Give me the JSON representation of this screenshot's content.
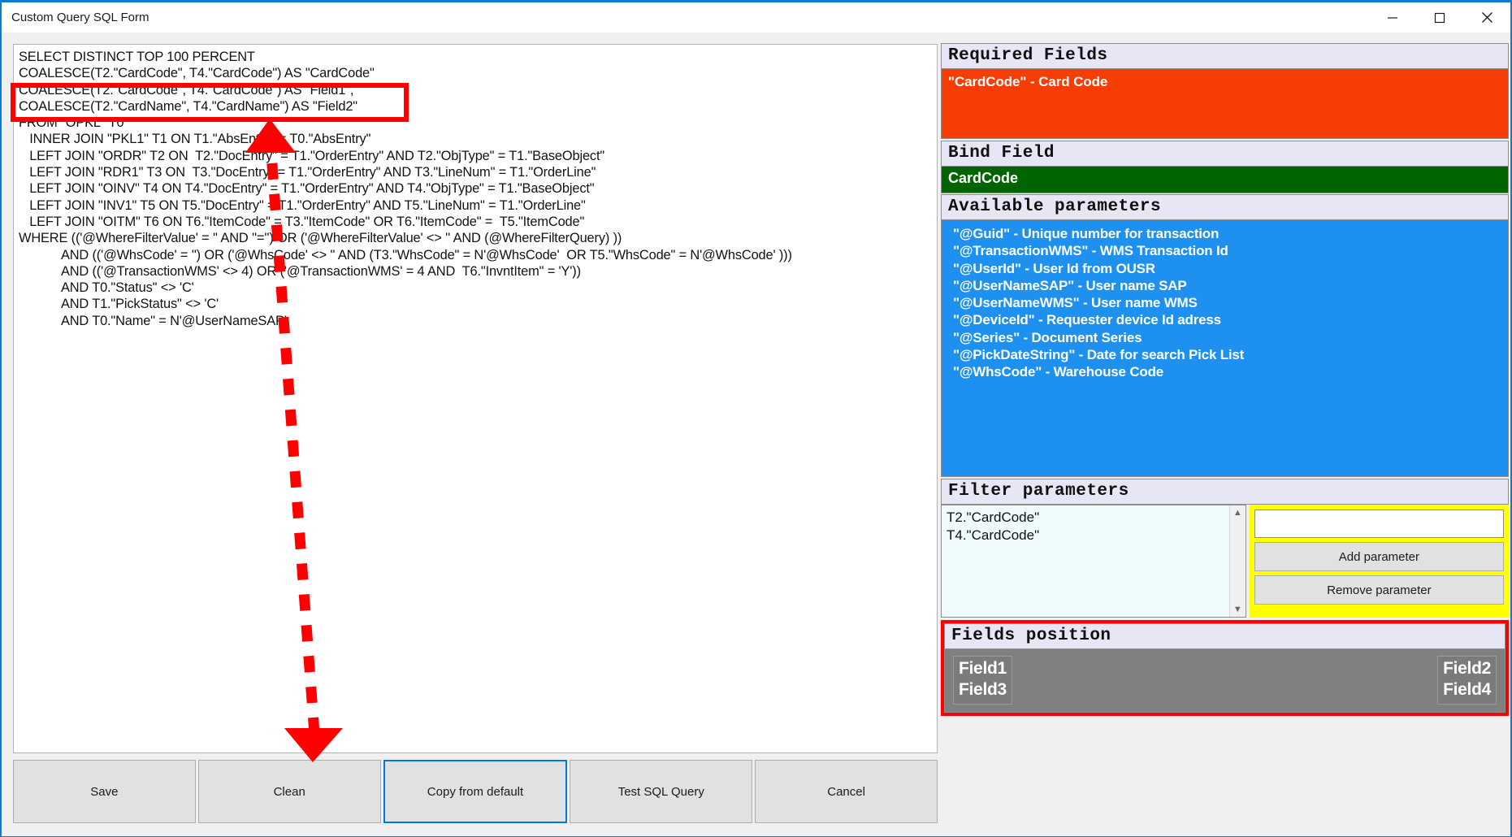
{
  "window": {
    "title": "Custom Query SQL Form",
    "controls": [
      {
        "name": "minimize",
        "glyph": "minimize-icon"
      },
      {
        "name": "maximize",
        "glyph": "maximize-icon"
      },
      {
        "name": "close",
        "glyph": "close-icon"
      }
    ]
  },
  "editor": {
    "sql": "SELECT DISTINCT TOP 100 PERCENT\nCOALESCE(T2.\"CardCode\", T4.\"CardCode\") AS \"CardCode\"\nCOALESCE(T2.\"CardCode\", T4.\"CardCode\") AS \"Field1\",\nCOALESCE(T2.\"CardName\", T4.\"CardName\") AS \"Field2\"\nFROM \"OPKL\" T0\n   INNER JOIN \"PKL1\" T1 ON T1.\"AbsEntry\" = T0.\"AbsEntry\"\n   LEFT JOIN \"ORDR\" T2 ON  T2.\"DocEntry\" = T1.\"OrderEntry\" AND T2.\"ObjType\" = T1.\"BaseObject\"\n   LEFT JOIN \"RDR1\" T3 ON  T3.\"DocEntry\" = T1.\"OrderEntry\" AND T3.\"LineNum\" = T1.\"OrderLine\"\n   LEFT JOIN \"OINV\" T4 ON T4.\"DocEntry\" = T1.\"OrderEntry\" AND T4.\"ObjType\" = T1.\"BaseObject\"\n   LEFT JOIN \"INV1\" T5 ON T5.\"DocEntry\" = T1.\"OrderEntry\" AND T5.\"LineNum\" = T1.\"OrderLine\"\n   LEFT JOIN \"OITM\" T6 ON T6.\"ItemCode\" = T3.\"ItemCode\" OR T6.\"ItemCode\" =  T5.\"ItemCode\"\nWHERE (('@WhereFilterValue' = '' AND ''='') OR ('@WhereFilterValue' <> '' AND (@WhereFilterQuery) ))\n            AND (('@WhsCode' = '') OR ('@WhsCode' <> '' AND (T3.\"WhsCode\" = N'@WhsCode'  OR T5.\"WhsCode\" = N'@WhsCode' )))\n            AND (('@TransactionWMS' <> 4) OR ('@TransactionWMS' = 4 AND  T6.\"InvntItem\" = 'Y'))\n            AND T0.\"Status\" <> 'C'\n            AND T1.\"PickStatus\" <> 'C'\n            AND T0.\"Name\" = N'@UserNameSAP'"
  },
  "buttons": {
    "save": "Save",
    "clean": "Clean",
    "copy_from_default": "Copy from default",
    "test_sql_query": "Test SQL Query",
    "cancel": "Cancel"
  },
  "required_fields": {
    "header": "Required Fields",
    "items": [
      "\"CardCode\" - Card Code"
    ]
  },
  "bind_field": {
    "header": "Bind Field",
    "value": "CardCode"
  },
  "available_parameters": {
    "header": "Available parameters",
    "items": [
      "\"@Guid\" - Unique number for transaction",
      "\"@TransactionWMS\" - WMS Transaction Id",
      "\"@UserId\" - User Id from OUSR",
      "\"@UserNameSAP\" - User name SAP",
      "\"@UserNameWMS\" - User name WMS",
      "\"@DeviceId\" - Requester device Id adress",
      "\"@Series\" - Document Series",
      "\"@PickDateString\" - Date for search Pick List",
      "\"@WhsCode\" - Warehouse Code"
    ]
  },
  "filter_parameters": {
    "header": "Filter parameters",
    "items": [
      "T2.\"CardCode\"",
      "T4.\"CardCode\""
    ],
    "input_value": "",
    "input_placeholder": "",
    "add_button": "Add parameter",
    "remove_button": "Remove parameter"
  },
  "fields_position": {
    "header": "Fields position",
    "left": [
      "Field1",
      "Field3"
    ],
    "right": [
      "Field2",
      "Field4"
    ]
  },
  "colors": {
    "accent": "#0a7cd4",
    "required_bg": "#f63e04",
    "bind_bg": "#006400",
    "params_bg": "#1e90ef",
    "filter_panel_bg": "#ffff00",
    "annotation": "#ff0000",
    "fields_canvas_bg": "#808080"
  }
}
